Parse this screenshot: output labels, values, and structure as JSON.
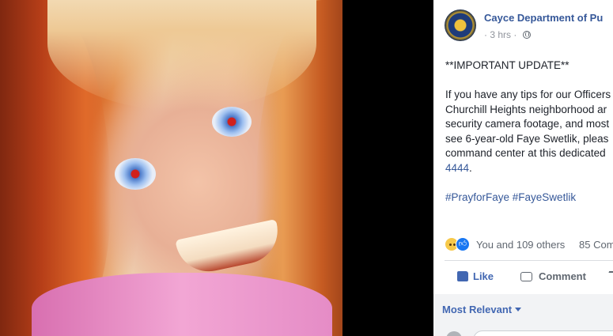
{
  "post": {
    "page_name": "Cayce Department of Pu",
    "time": "3 hrs",
    "privacy_icon": "globe-icon",
    "lines": [
      "**IMPORTANT UPDATE**",
      "",
      "If you have any tips for our Officers",
      "Churchill Heights neighborhood ar",
      "security camera footage, and most",
      "see 6-year-old Faye Swetlik, pleas",
      "command center at this dedicated"
    ],
    "phone_fragment": "4444",
    "phone_suffix": ".",
    "hashtags": "#PrayforFaye #FayeSwetlik"
  },
  "reactions": {
    "summary": "You and 109 others",
    "comments_count": "85 Com",
    "icons": [
      "sad-reaction-icon",
      "like-reaction-icon"
    ]
  },
  "actions": {
    "like_label": "Like",
    "comment_label": "Comment"
  },
  "comments": {
    "sort_label": "Most Relevant"
  },
  "colors": {
    "link": "#365899",
    "like_blue": "#4267b2",
    "meta_gray": "#90949c"
  }
}
